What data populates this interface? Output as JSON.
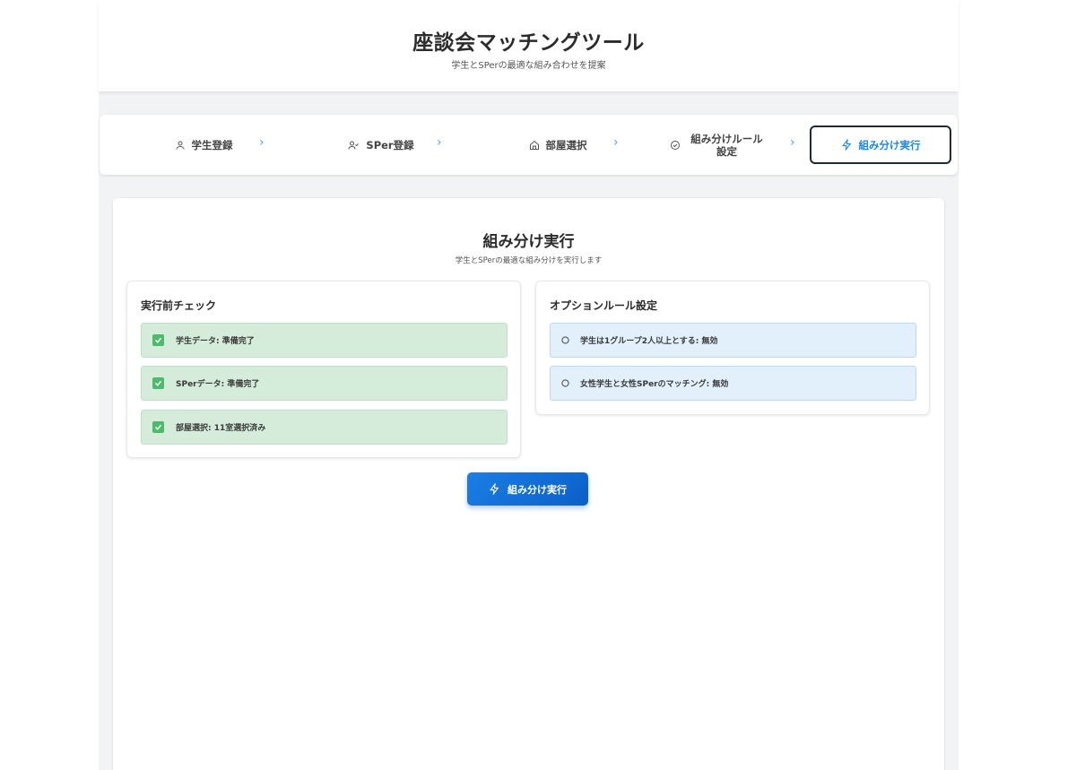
{
  "header": {
    "title": "座談会マッチングツール",
    "subtitle": "学生とSPerの最適な組み合わせを提案"
  },
  "steps": [
    {
      "label": "学生登録",
      "icon": "user-icon"
    },
    {
      "label": "SPer登録",
      "icon": "user-check-icon"
    },
    {
      "label": "部屋選択",
      "icon": "home-icon"
    },
    {
      "label": "組み分けルール設定",
      "icon": "check-circle-icon"
    },
    {
      "label": "組み分け実行",
      "icon": "zap-icon",
      "active": true
    }
  ],
  "step_separator": "›",
  "main": {
    "title": "組み分け実行",
    "subtitle": "学生とSPerの最適な組み分けを実行します"
  },
  "precheck": {
    "title": "実行前チェック",
    "items": [
      "学生データ: 準備完了",
      "SPerデータ: 準備完了",
      "部屋選択: 11室選択済み"
    ]
  },
  "options": {
    "title": "オプションルール設定",
    "items": [
      "学生は1グループ2人以上とする: 無効",
      "女性学生と女性SPerのマッチング: 無効"
    ]
  },
  "run_button": {
    "label": "組み分け実行"
  },
  "colors": {
    "accent": "#1e88e5",
    "success_bg": "#d4ecd9",
    "check_green": "#4cbb6c",
    "option_bg": "#e2f0fb"
  }
}
